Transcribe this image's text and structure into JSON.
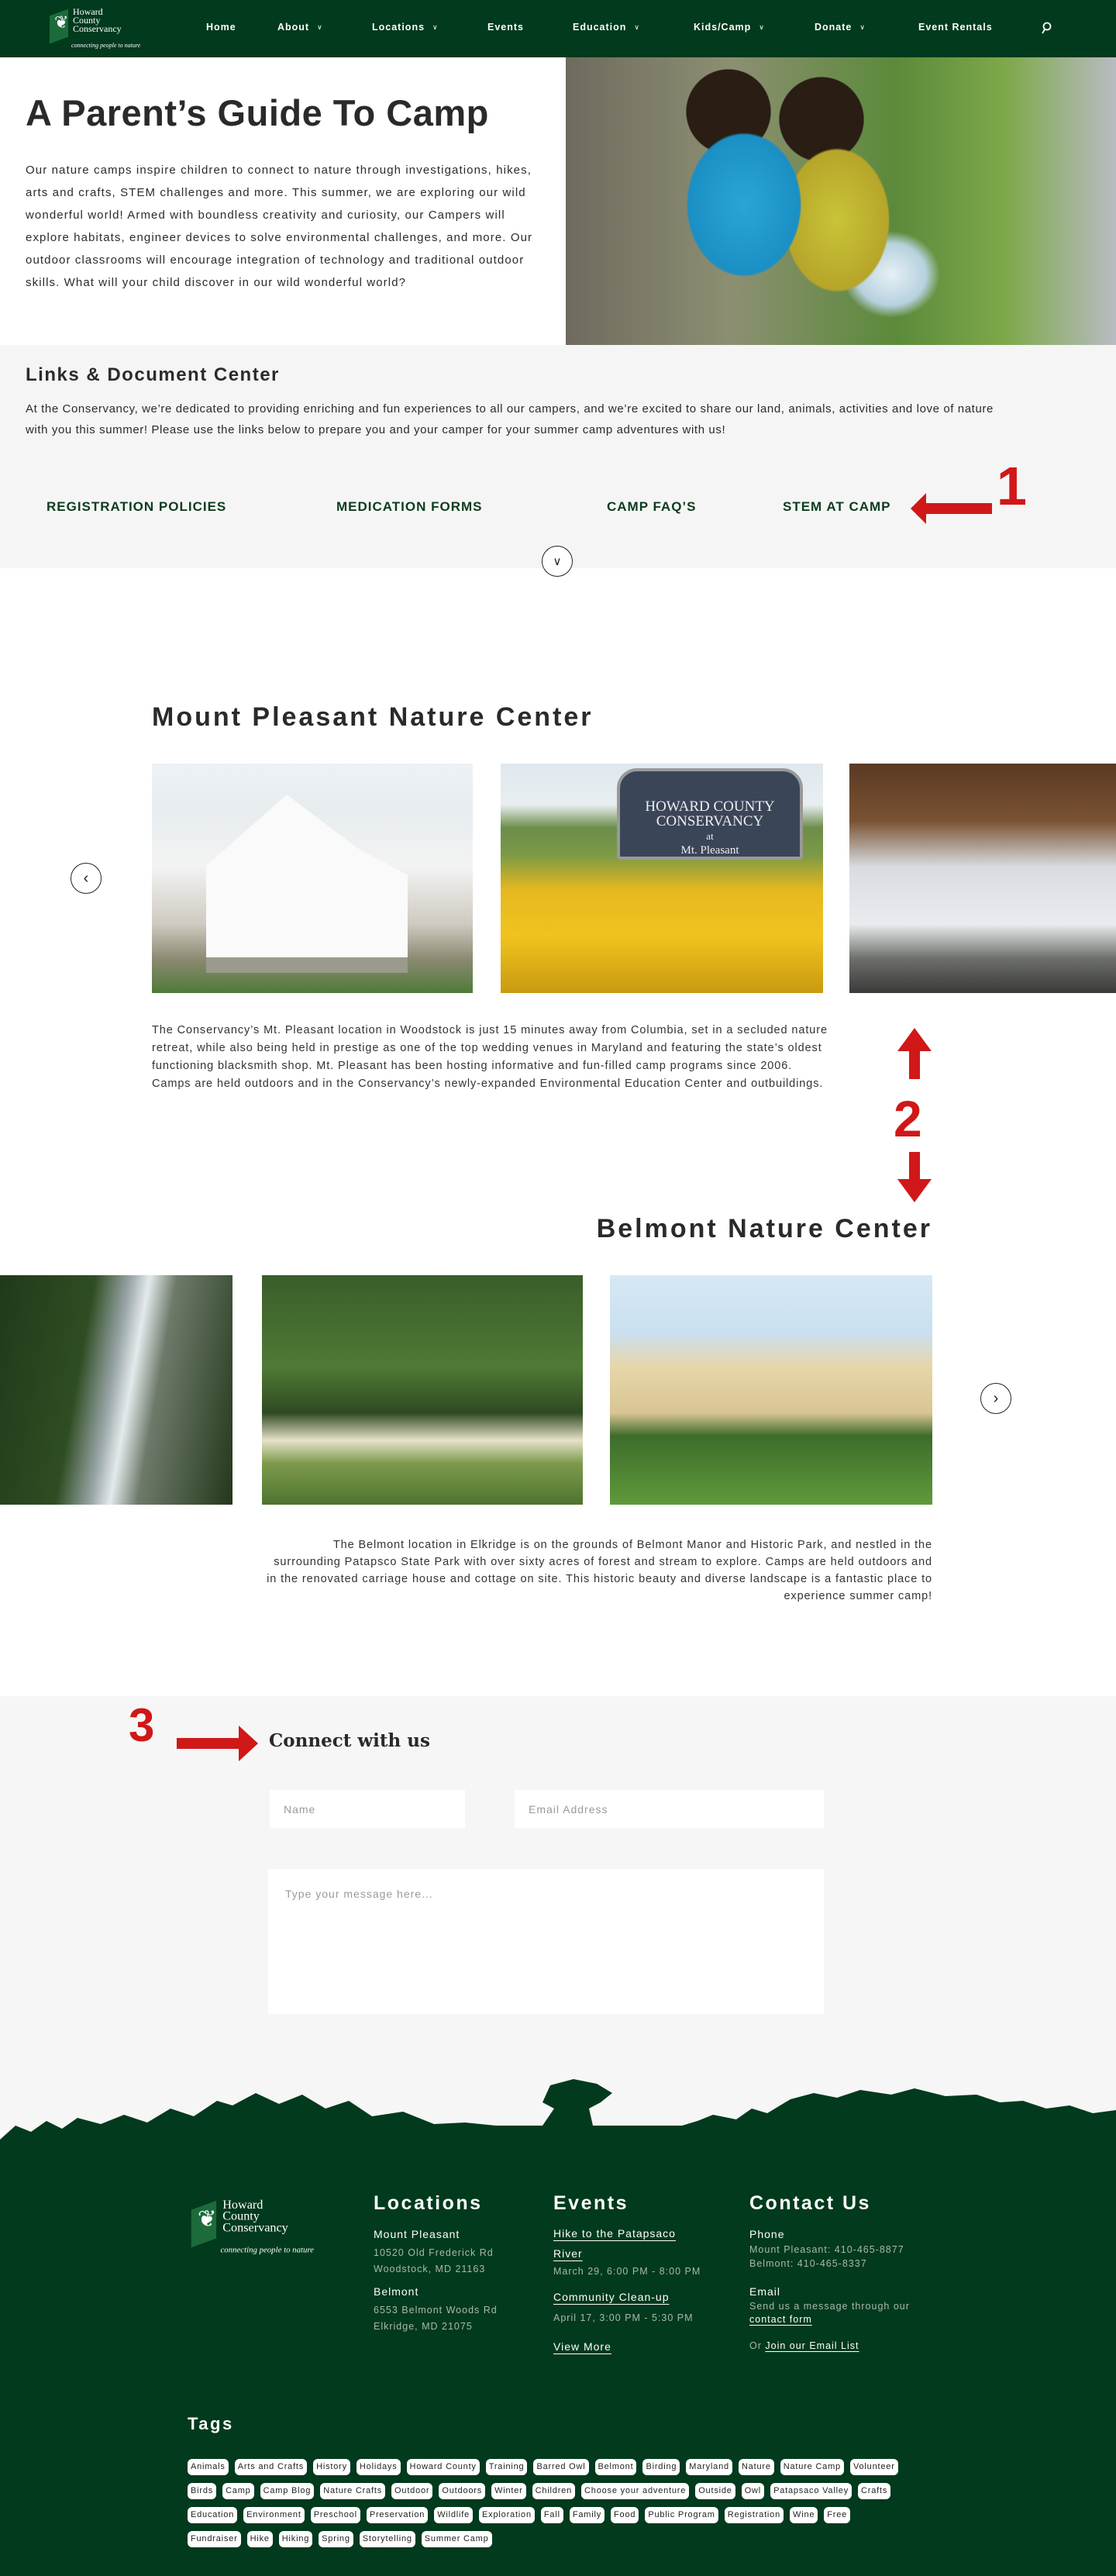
{
  "nav": {
    "logo": {
      "line1": "Howard",
      "line2": "County",
      "line3": "Conservancy",
      "tagline": "connecting people to nature"
    },
    "items": [
      {
        "label": "Home",
        "dropdown": false
      },
      {
        "label": "About",
        "dropdown": true
      },
      {
        "label": "Locations",
        "dropdown": true
      },
      {
        "label": "Events",
        "dropdown": false
      },
      {
        "label": "Education",
        "dropdown": true
      },
      {
        "label": "Kids/Camp",
        "dropdown": true
      },
      {
        "label": "Donate",
        "dropdown": true
      },
      {
        "label": "Event Rentals",
        "dropdown": false
      }
    ],
    "search_icon": "search-icon"
  },
  "hero": {
    "title": "A Parent’s Guide To Camp",
    "body": "Our nature camps inspire children to connect to nature through investigations, hikes, arts and crafts, STEM challenges and more. This summer, we are exploring our wild wonderful world! Armed with boundless creativity and curiosity, our Campers will explore habitats, engineer devices to solve environmental challenges, and more. Our outdoor classrooms will encourage integration of technology and traditional outdoor skills. What will your child discover in our wild wonderful world?"
  },
  "links": {
    "title": "Links & Document Center",
    "body": "At the Conservancy, we’re dedicated to providing enriching and fun experiences to all our campers, and we’re excited to share our land, animals, activities and love of nature with you this summer! Please use the links below to prepare you and your camper for your summer camp adventures with us!",
    "items": [
      "REGISTRATION POLICIES",
      "MEDICATION FORMS",
      "CAMP FAQ’S",
      "STEM AT CAMP"
    ]
  },
  "annotations": {
    "one": "1",
    "two": "2",
    "three": "3",
    "color": "#d01818"
  },
  "mount_pleasant": {
    "title": "Mount Pleasant Nature Center",
    "body": "The Conservancy’s Mt. Pleasant location in Woodstock is just 15 minutes away from Columbia, set in a secluded nature retreat, while also being held in prestige as one of the top wedding venues in Maryland and featuring the state’s oldest functioning blacksmith shop. Mt. Pleasant has been hosting informative and fun-filled camp programs since 2006. Camps are held outdoors and in the Conservancy’s newly-expanded Environmental Education Center and outbuildings.",
    "sign_text": {
      "line1": "HOWARD COUNTY",
      "line2": "CONSERVANCY",
      "line3": "at",
      "line4": "Mt. Pleasant"
    }
  },
  "belmont": {
    "title": "Belmont Nature Center",
    "body": "The Belmont location in Elkridge is on the grounds of Belmont Manor and Historic Park, and nestled in the surrounding Patapsco State Park with over sixty acres of forest and stream to explore. Camps are held outdoors and in the renovated carriage house and cottage on site. This historic beauty and diverse landscape is a fantastic place to experience summer camp!"
  },
  "connect": {
    "title": "Connect with us",
    "name_placeholder": "Name",
    "email_placeholder": "Email Address",
    "message_placeholder": "Type your message here..."
  },
  "footer": {
    "locations": {
      "title": "Locations",
      "mp_name": "Mount Pleasant",
      "mp_addr1": "10520 Old Frederick Rd",
      "mp_addr2": "Woodstock, MD 21163",
      "b_name": "Belmont",
      "b_addr1": "6553 Belmont Woods Rd",
      "b_addr2": "Elkridge, MD 21075"
    },
    "events": {
      "title": "Events",
      "items": [
        {
          "name": "Hike to the Patapsaco River",
          "date": "March 29, 6:00 PM - 8:00 PM"
        },
        {
          "name": "Community Clean-up",
          "date": "April 17, 3:00 PM - 5:30 PM"
        }
      ],
      "view_more": "View More"
    },
    "contact": {
      "title": "Contact Us",
      "phone_label": "Phone",
      "phone_mp": "Mount Pleasant: 410-465-8877",
      "phone_b": "Belmont: 410-465-8337",
      "email_label": "Email",
      "email_text": "Send us a message through our",
      "contact_form": "contact form",
      "or": "Or",
      "join": "Join our Email List"
    },
    "tags_title": "Tags",
    "tags": [
      "Animals",
      "Arts and Crafts",
      "History",
      "Holidays",
      "Howard County",
      "Training",
      "Barred Owl",
      "Belmont",
      "Birding",
      "Maryland",
      "Nature",
      "Nature Camp",
      "Volunteer",
      "Birds",
      "Camp",
      "Camp Blog",
      "Nature Crafts",
      "Outdoor",
      "Outdoors",
      "Winter",
      "Children",
      "Choose your adventure",
      "Outside",
      "Owl",
      "Patapsaco Valley",
      "Crafts",
      "Education",
      "Environment",
      "Preschool",
      "Preservation",
      "Wildlife",
      "Exploration",
      "Fall",
      "Family",
      "Food",
      "Public Program",
      "Registration",
      "Wine",
      "Free",
      "Fundraiser",
      "Hike",
      "Hiking",
      "Spring",
      "Storytelling",
      "Summer Camp"
    ]
  },
  "colors": {
    "brand_green": "#013a1d",
    "link_green": "#0d3b1e",
    "section_gray": "#f5f5f5"
  }
}
